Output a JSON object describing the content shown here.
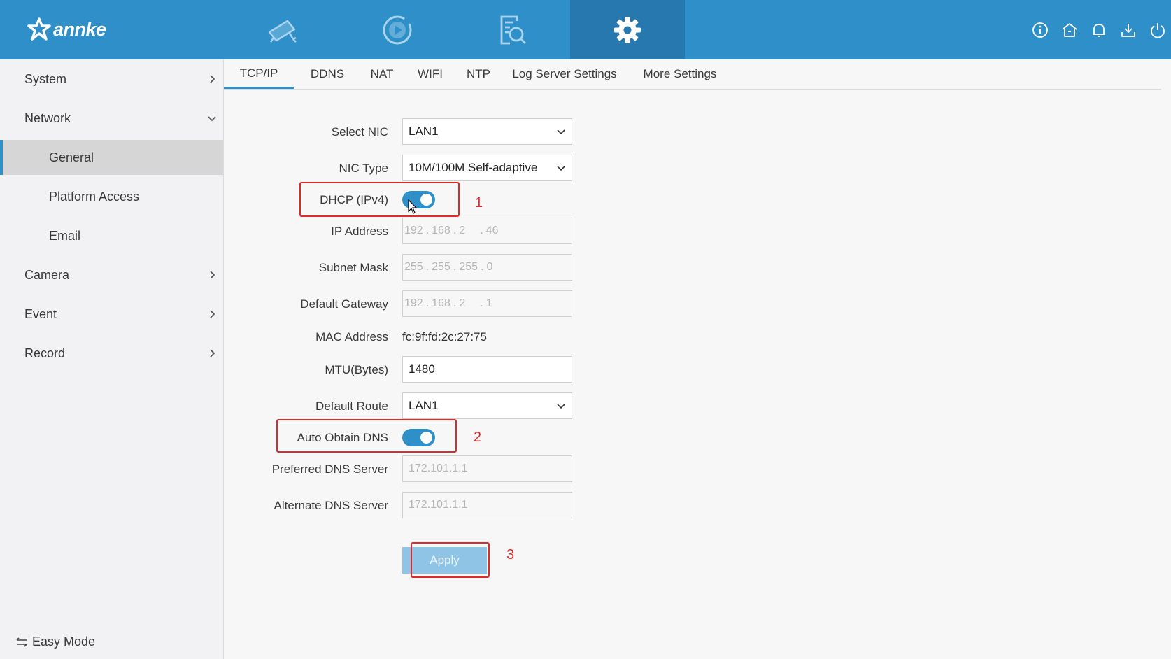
{
  "header": {
    "logo_text": "annke",
    "nav": [
      {
        "name": "live-view",
        "icon": "camera-icon"
      },
      {
        "name": "playback",
        "icon": "play-icon"
      },
      {
        "name": "search",
        "icon": "file-search-icon"
      },
      {
        "name": "configuration",
        "icon": "gear-icon",
        "active": true
      }
    ],
    "right_icons": [
      "info-icon",
      "home-icon",
      "bell-icon",
      "download-icon",
      "power-icon"
    ],
    "colors": {
      "bar": "#2f8fc8",
      "active_tab": "#2678ae"
    }
  },
  "sidebar": {
    "items": [
      {
        "label": "System",
        "chevron": "right"
      },
      {
        "label": "Network",
        "chevron": "down"
      },
      {
        "label": "General",
        "active": true
      },
      {
        "label": "Platform Access"
      },
      {
        "label": "Email"
      },
      {
        "label": "Camera",
        "chevron": "right"
      },
      {
        "label": "Event",
        "chevron": "right"
      },
      {
        "label": "Record",
        "chevron": "right"
      }
    ],
    "easy_mode": "Easy Mode"
  },
  "tabs": [
    "TCP/IP",
    "DDNS",
    "NAT",
    "WIFI",
    "NTP",
    "Log Server Settings",
    "More Settings"
  ],
  "form": {
    "select_nic": {
      "label": "Select NIC",
      "value": "LAN1"
    },
    "nic_type": {
      "label": "NIC Type",
      "value": "10M/100M Self-adaptive"
    },
    "dhcp": {
      "label": "DHCP (IPv4)",
      "on": true
    },
    "ip_address": {
      "label": "IP Address",
      "octets": [
        "192",
        "168",
        "2",
        "46"
      ]
    },
    "subnet_mask": {
      "label": "Subnet Mask",
      "octets": [
        "255",
        "255",
        "255",
        "0"
      ]
    },
    "default_gateway": {
      "label": "Default Gateway",
      "octets": [
        "192",
        "168",
        "2",
        "1"
      ]
    },
    "mac_address": {
      "label": "MAC Address",
      "value": "fc:9f:fd:2c:27:75"
    },
    "mtu": {
      "label": "MTU(Bytes)",
      "value": "1480"
    },
    "default_route": {
      "label": "Default Route",
      "value": "LAN1"
    },
    "auto_dns": {
      "label": "Auto Obtain DNS",
      "on": true
    },
    "preferred_dns": {
      "label": "Preferred DNS Server",
      "value": "172.101.1.1"
    },
    "alternate_dns": {
      "label": "Alternate DNS Server",
      "value": "172.101.1.1"
    },
    "apply": "Apply"
  },
  "annotations": {
    "n1": "1",
    "n2": "2",
    "n3": "3",
    "color": "#e02a2a"
  }
}
